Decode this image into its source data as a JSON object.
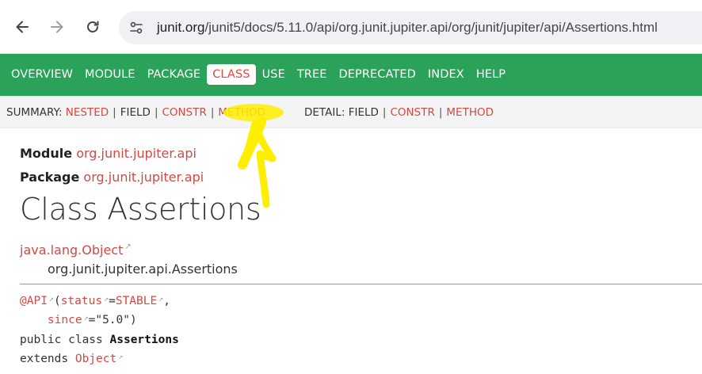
{
  "browser": {
    "url_domain": "junit.org",
    "url_path": "/junit5/docs/5.11.0/api/org.junit.jupiter.api/org/junit/jupiter/api/Assertions.html"
  },
  "top_nav": {
    "items": [
      {
        "label": "OVERVIEW"
      },
      {
        "label": "MODULE"
      },
      {
        "label": "PACKAGE"
      },
      {
        "label": "CLASS",
        "active": true
      },
      {
        "label": "USE"
      },
      {
        "label": "TREE"
      },
      {
        "label": "DEPRECATED"
      },
      {
        "label": "INDEX"
      },
      {
        "label": "HELP"
      }
    ]
  },
  "sub_nav": {
    "summary_label": "SUMMARY:",
    "summary_nested": "NESTED",
    "summary_field": "FIELD",
    "summary_constr": "CONSTR",
    "summary_method": "METHOD",
    "detail_label": "DETAIL:",
    "detail_field": "FIELD",
    "detail_constr": "CONSTR",
    "detail_method": "METHOD",
    "separator": "|"
  },
  "header": {
    "module_label": "Module",
    "module_value": "org.junit.jupiter.api",
    "package_label": "Package",
    "package_value": "org.junit.jupiter.api",
    "class_title": "Class Assertions"
  },
  "inheritance": {
    "root": "java.lang.Object",
    "child": "org.junit.jupiter.api.Assertions"
  },
  "signature": {
    "annotation": "@API",
    "open_paren": "(",
    "status_key": "status",
    "equals": "=",
    "status_value": "STABLE",
    "comma": ",",
    "since_key": "since",
    "since_value": "=\"5.0\")",
    "modifiers": "public class ",
    "class_name": "Assertions",
    "extends_kw": "extends ",
    "extends_type": "Object"
  },
  "colors": {
    "nav_green": "#2aa25a",
    "link_red": "#d24a43",
    "highlight_yellow": "#ffee00"
  }
}
